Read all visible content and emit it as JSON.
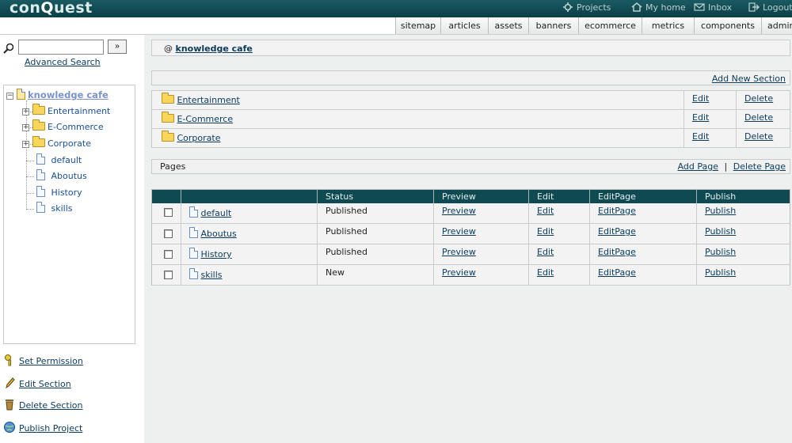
{
  "app": {
    "logo_pre": "con",
    "logo_q": "Q",
    "logo_post": "uest"
  },
  "top_links": {
    "projects": "Projects",
    "my_home": "My home",
    "inbox": "Inbox",
    "logout": "Logout"
  },
  "nav_tabs": [
    "sitemap",
    "articles",
    "assets",
    "banners",
    "ecommerce",
    "metrics",
    "components",
    "admin"
  ],
  "search": {
    "value": "",
    "placeholder": "",
    "go_label": "»",
    "advanced_label": "Advanced Search"
  },
  "tree": {
    "root": "knowledge cafe",
    "folders": [
      "Entertainment",
      "E-Commerce",
      "Corporate"
    ],
    "pages": [
      "default",
      "Aboutus",
      "History",
      "skills"
    ]
  },
  "side_actions": {
    "set_permission": "Set Permission",
    "edit_section": "Edit Section",
    "delete_section": "Delete Section",
    "publish_project": "Publish Project"
  },
  "breadcrumb": {
    "prefix": "@",
    "current": "knowledge cafe"
  },
  "sections_header": {
    "add_label": "Add New Section"
  },
  "sections": [
    {
      "name": "Entertainment",
      "edit": "Edit",
      "delete": "Delete"
    },
    {
      "name": "E-Commerce",
      "edit": "Edit",
      "delete": "Delete"
    },
    {
      "name": "Corporate",
      "edit": "Edit",
      "delete": "Delete"
    }
  ],
  "pages_header": {
    "title": "Pages",
    "add_label": "Add Page",
    "separator": "|",
    "delete_label": "Delete Page"
  },
  "pages_table": {
    "columns": [
      "",
      "",
      "Status",
      "Preview",
      "Edit",
      "EditPage",
      "Publish"
    ],
    "rows": [
      {
        "name": "default",
        "status": "Published",
        "preview": "Preview",
        "edit": "Edit",
        "editpage": "EditPage",
        "publish": "Publish"
      },
      {
        "name": "Aboutus",
        "status": "Published",
        "preview": "Preview",
        "edit": "Edit",
        "editpage": "EditPage",
        "publish": "Publish"
      },
      {
        "name": "History",
        "status": "Published",
        "preview": "Preview",
        "edit": "Edit",
        "editpage": "EditPage",
        "publish": "Publish"
      },
      {
        "name": "skills",
        "status": "New",
        "preview": "Preview",
        "edit": "Edit",
        "editpage": "EditPage",
        "publish": "Publish"
      }
    ]
  },
  "colors": {
    "header_bg": "#0f4a52",
    "link": "#0a3b5c",
    "tree_link": "#1a4f96"
  }
}
